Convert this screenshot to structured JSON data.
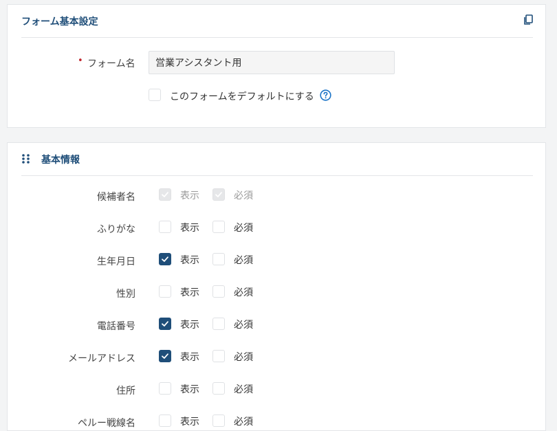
{
  "form_settings": {
    "title": "フォーム基本設定",
    "form_name_label": "フォーム名",
    "form_name_value": "営業アシスタント用",
    "default_label": "このフォームをデフォルトにする"
  },
  "basic_info": {
    "title": "基本情報",
    "show_label": "表示",
    "required_label": "必須",
    "fields": [
      {
        "label": "候補者名",
        "show": true,
        "required": true,
        "locked": true
      },
      {
        "label": "ふりがな",
        "show": false,
        "required": false,
        "locked": false
      },
      {
        "label": "生年月日",
        "show": true,
        "required": false,
        "locked": false
      },
      {
        "label": "性別",
        "show": false,
        "required": false,
        "locked": false
      },
      {
        "label": "電話番号",
        "show": true,
        "required": false,
        "locked": false
      },
      {
        "label": "メールアドレス",
        "show": true,
        "required": false,
        "locked": false
      },
      {
        "label": "住所",
        "show": false,
        "required": false,
        "locked": false
      },
      {
        "label": "ペルー戦線名",
        "show": false,
        "required": false,
        "locked": false
      }
    ]
  },
  "colors": {
    "accent": "#1f4e79",
    "required_marker": "#c0252d",
    "help": "#1a73c7"
  }
}
